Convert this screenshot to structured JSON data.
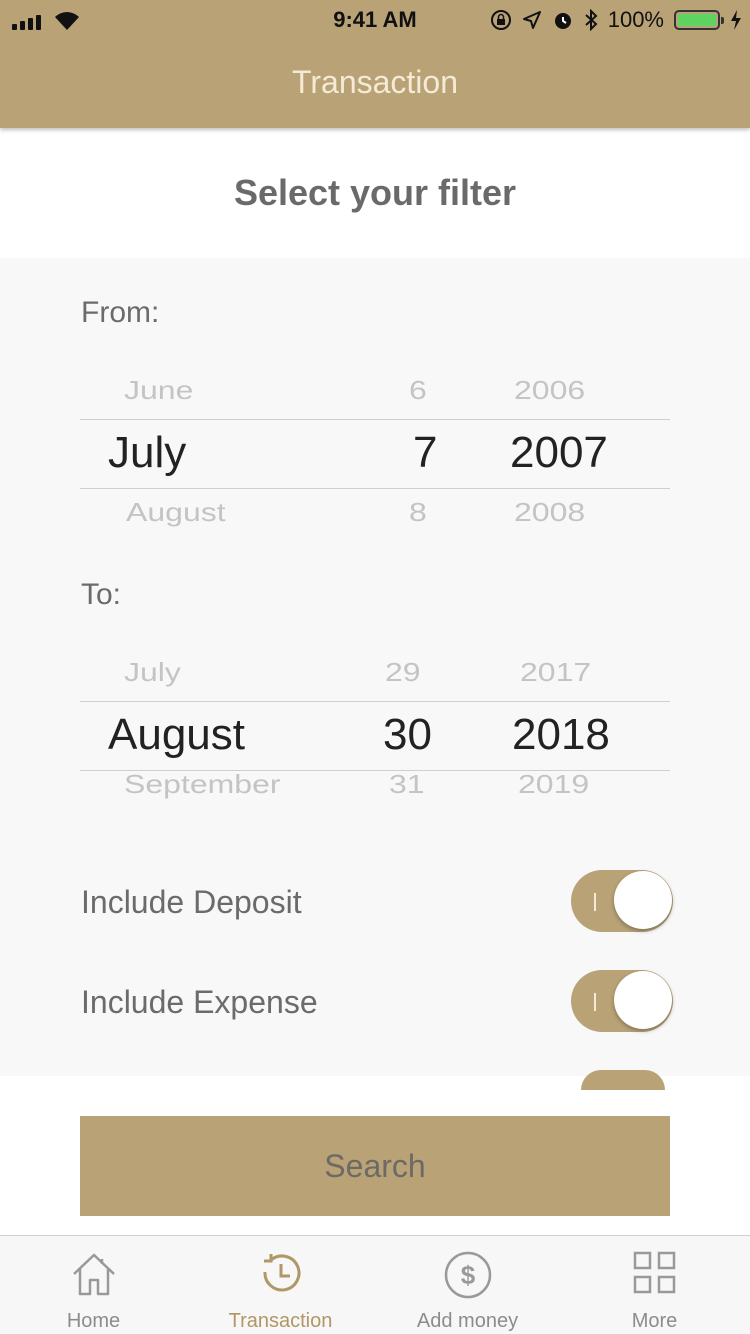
{
  "status_bar": {
    "time": "9:41 AM",
    "battery": "100%",
    "icons": [
      "signal-icon",
      "wifi-icon",
      "lock-rotation-icon",
      "location-icon",
      "alarm-icon",
      "bluetooth-icon",
      "battery-icon",
      "charging-icon"
    ]
  },
  "nav": {
    "title": "Transaction"
  },
  "filter": {
    "title": "Select your filter"
  },
  "from": {
    "label": "From:",
    "prev": {
      "month": "June",
      "day": "6",
      "year": "2006"
    },
    "selected": {
      "month": "July",
      "day": "7",
      "year": "2007"
    },
    "next": {
      "month": "August",
      "day": "8",
      "year": "2008"
    }
  },
  "to": {
    "label": "To:",
    "prev": {
      "month": "July",
      "day": "29",
      "year": "2017"
    },
    "selected": {
      "month": "August",
      "day": "30",
      "year": "2018"
    },
    "next": {
      "month": "September",
      "day": "31",
      "year": "2019"
    }
  },
  "toggles": [
    {
      "label": "Include Deposit",
      "on": true
    },
    {
      "label": "Include Expense",
      "on": true
    }
  ],
  "search": {
    "label": "Search"
  },
  "tabbar": [
    {
      "label": "Home",
      "icon": "home-icon",
      "active": false
    },
    {
      "label": "Transaction",
      "icon": "history-icon",
      "active": true
    },
    {
      "label": "Add money",
      "icon": "dollar-icon",
      "active": false
    },
    {
      "label": "More",
      "icon": "grid-icon",
      "active": false
    }
  ],
  "colors": {
    "accent": "#b9a276",
    "nav_text": "#f4ead6",
    "panel": "#f8f8f8"
  }
}
